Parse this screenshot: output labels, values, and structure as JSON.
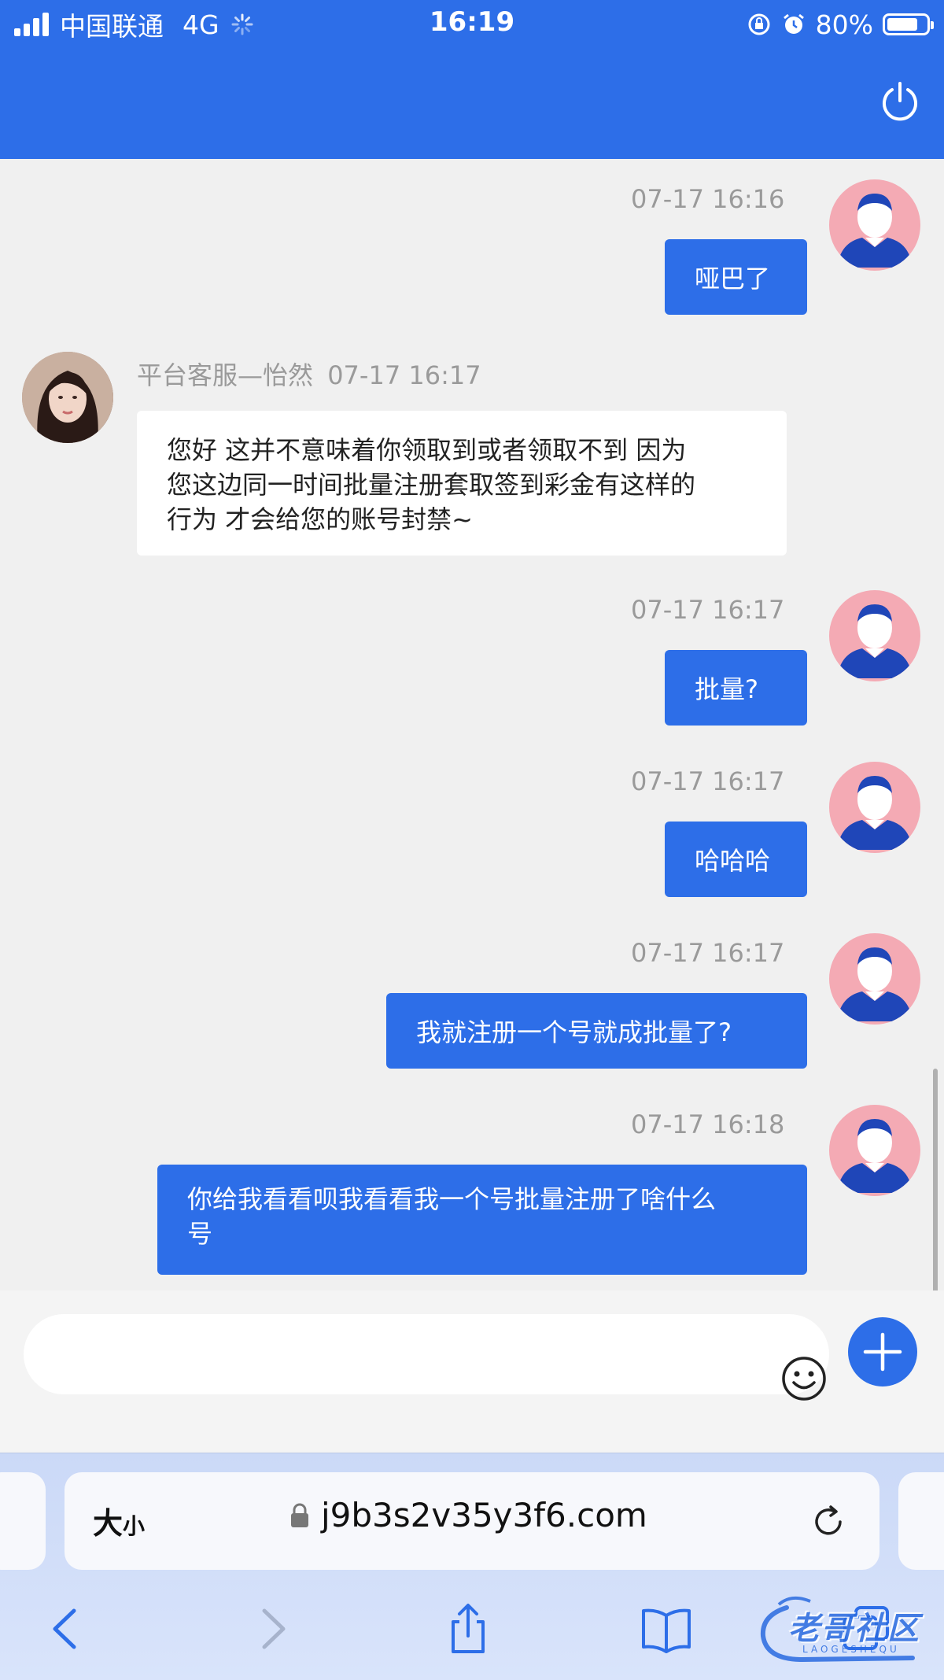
{
  "status_bar": {
    "carrier": "中国联通",
    "network": "4G",
    "time": "16:19",
    "battery": "80%",
    "battery_level": 0.8
  },
  "colors": {
    "brand": "#2d6ee8",
    "user_avatar_bg": "#f4aab4"
  },
  "messages": [
    {
      "side": "out",
      "time": "07-17 16:16",
      "text": "哑巴了"
    },
    {
      "side": "in",
      "sender": "平台客服—怡然",
      "time": "07-17 16:17",
      "text_lines": [
        "您好 这并不意味着你领取到或者领取不到 因为",
        "您这边同一时间批量注册套取签到彩金有这样的",
        "行为 才会给您的账号封禁~"
      ]
    },
    {
      "side": "out",
      "time": "07-17 16:17",
      "text": "批量?"
    },
    {
      "side": "out",
      "time": "07-17 16:17",
      "text": "哈哈哈"
    },
    {
      "side": "out",
      "time": "07-17 16:17",
      "text": "我就注册一个号就成批量了?"
    },
    {
      "side": "out",
      "time": "07-17 16:18",
      "text_lines": [
        "你给我看看呗我看看我一个号批量注册了啥什么",
        "号"
      ]
    }
  ],
  "input": {
    "placeholder": "",
    "emoji_icon": "smiley-icon",
    "plus_icon": "plus-icon"
  },
  "browser": {
    "text_size_big": "大",
    "text_size_small": "小",
    "url": "j9b3s2v35y3f6.com",
    "lock_icon": "lock-icon",
    "reload_icon": "reload-icon"
  },
  "watermark": {
    "text": "老哥社区",
    "sub": "LAOGESHEQU"
  }
}
